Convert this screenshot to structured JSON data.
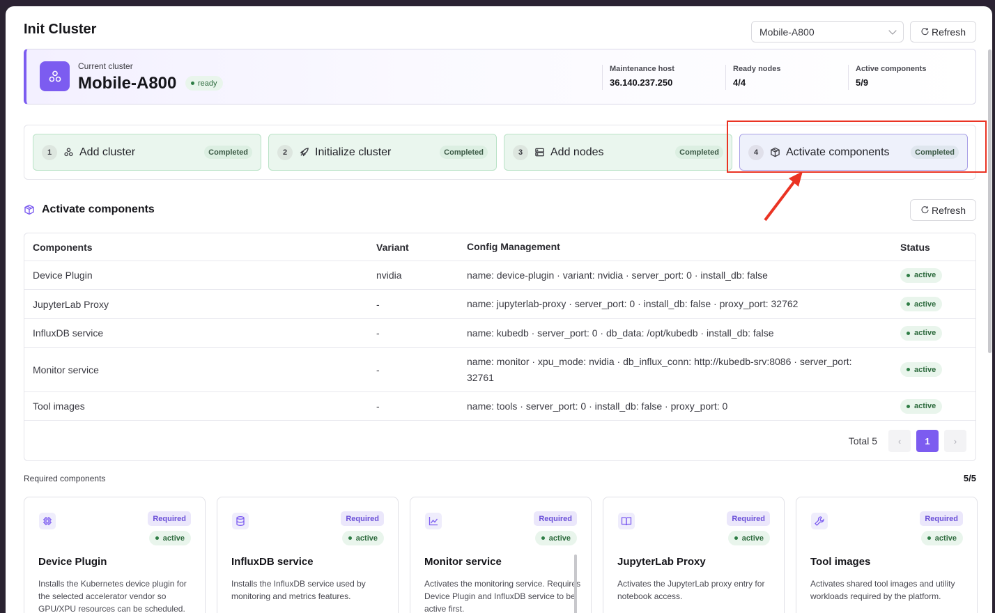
{
  "header": {
    "title": "Init Cluster",
    "cluster_select_value": "Mobile-A800",
    "refresh_label": "Refresh"
  },
  "cluster": {
    "label": "Current cluster",
    "name": "Mobile-A800",
    "status": "ready",
    "stats": [
      {
        "label": "Maintenance host",
        "value": "36.140.237.250"
      },
      {
        "label": "Ready nodes",
        "value": "4/4"
      },
      {
        "label": "Active components",
        "value": "5/9"
      }
    ]
  },
  "steps": [
    {
      "num": "1",
      "icon": "cluster-icon",
      "label": "Add cluster",
      "status": "Completed"
    },
    {
      "num": "2",
      "icon": "rocket-icon",
      "label": "Initialize cluster",
      "status": "Completed"
    },
    {
      "num": "3",
      "icon": "server-icon",
      "label": "Add nodes",
      "status": "Completed"
    },
    {
      "num": "4",
      "icon": "package-icon",
      "label": "Activate components",
      "status": "Completed"
    }
  ],
  "section": {
    "title": "Activate components",
    "refresh_label": "Refresh"
  },
  "table": {
    "columns": [
      "Components",
      "Variant",
      "Config Management",
      "Status"
    ],
    "rows": [
      {
        "component": "Device Plugin",
        "variant": "nvidia",
        "config": "name: device-plugin · variant: nvidia · server_port: 0 · install_db: false",
        "status": "active"
      },
      {
        "component": "JupyterLab Proxy",
        "variant": "-",
        "config": "name: jupyterlab-proxy · server_port: 0 · install_db: false · proxy_port: 32762",
        "status": "active"
      },
      {
        "component": "InfluxDB service",
        "variant": "-",
        "config": "name: kubedb · server_port: 0 · db_data: /opt/kubedb · install_db: false",
        "status": "active"
      },
      {
        "component": "Monitor service",
        "variant": "-",
        "config": "name: monitor · xpu_mode: nvidia · db_influx_conn: http://kubedb-srv:8086 · server_port: 32761",
        "status": "active"
      },
      {
        "component": "Tool images",
        "variant": "-",
        "config": "name: tools · server_port: 0 · install_db: false · proxy_port: 0",
        "status": "active"
      }
    ],
    "total_label": "Total 5",
    "current_page": "1",
    "prev_icon": "chevron-left-icon",
    "next_icon": "chevron-right-icon"
  },
  "required": {
    "label": "Required components",
    "count": "5/5",
    "cards": [
      {
        "icon": "chip-icon",
        "badge": "Required",
        "status": "active",
        "title": "Device Plugin",
        "desc": "Installs the Kubernetes device plugin for the selected accelerator vendor so GPU/XPU resources can be scheduled."
      },
      {
        "icon": "database-icon",
        "badge": "Required",
        "status": "active",
        "title": "InfluxDB service",
        "desc": "Installs the InfluxDB service used by monitoring and metrics features."
      },
      {
        "icon": "chart-icon",
        "badge": "Required",
        "status": "active",
        "title": "Monitor service",
        "desc": "Activates the monitoring service. Requires Device Plugin and InfluxDB service to be active first."
      },
      {
        "icon": "book-icon",
        "badge": "Required",
        "status": "active",
        "title": "JupyterLab Proxy",
        "desc": "Activates the JupyterLab proxy entry for notebook access."
      },
      {
        "icon": "wrench-icon",
        "badge": "Required",
        "status": "active",
        "title": "Tool images",
        "desc": "Activates shared tool images and utility workloads required by the platform."
      }
    ]
  },
  "colors": {
    "accent": "#7c5cf0",
    "success": "#2e7d45",
    "highlight": "#ea3323"
  }
}
